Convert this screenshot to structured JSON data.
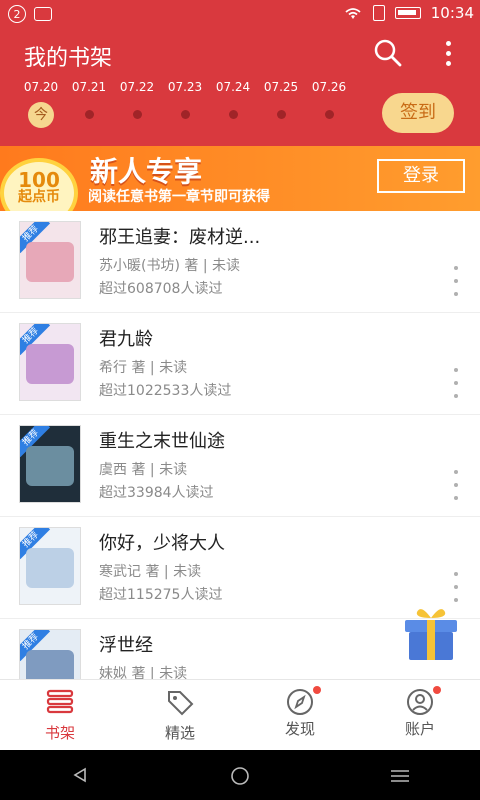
{
  "status": {
    "badge": "2",
    "time": "10:34"
  },
  "header": {
    "title": "我的书架",
    "signin_label": "签到",
    "colors": {
      "bar": "#d9393e"
    }
  },
  "calendar": {
    "days": [
      {
        "date": "07.20",
        "today": true,
        "today_label": "今"
      },
      {
        "date": "07.21",
        "today": false
      },
      {
        "date": "07.22",
        "today": false
      },
      {
        "date": "07.23",
        "today": false
      },
      {
        "date": "07.24",
        "today": false
      },
      {
        "date": "07.25",
        "today": false
      },
      {
        "date": "07.26",
        "today": false
      }
    ]
  },
  "banner": {
    "coin_number": "100",
    "coin_text": "起点币",
    "title": "新人专享",
    "subtitle": "阅读任意书第一章节即可获得",
    "login_label": "登录"
  },
  "books": [
    {
      "name": "邪王追妻：废材逆...",
      "meta": "苏小暖(书坊) 著 | 未读",
      "readers": "超过608708人读过",
      "tag": "推荐",
      "cover_color": "#e7a8b8"
    },
    {
      "name": "君九龄",
      "meta": "希行 著 | 未读",
      "readers": "超过1022533人读过",
      "tag": "推荐",
      "cover_color": "#c79ad3"
    },
    {
      "name": "重生之末世仙途",
      "meta": "虞西 著 | 未读",
      "readers": "超过33984人读过",
      "tag": "推荐",
      "cover_color": "#6b8ea0"
    },
    {
      "name": "你好，少将大人",
      "meta": "寒武记 著 | 未读",
      "readers": "超过115275人读过",
      "tag": "推荐",
      "cover_color": "#bcd0e6"
    },
    {
      "name": "浮世经",
      "meta": "妹姒 著 | 未读",
      "readers": "",
      "tag": "推荐",
      "cover_color": "#7f9bc0"
    }
  ],
  "tabs": [
    {
      "label": "书架",
      "icon": "bookshelf-icon",
      "active": true
    },
    {
      "label": "精选",
      "icon": "tag-icon",
      "active": false
    },
    {
      "label": "发现",
      "icon": "compass-icon",
      "active": false,
      "dot": true
    },
    {
      "label": "账户",
      "icon": "user-icon",
      "active": false,
      "dot": true
    }
  ]
}
